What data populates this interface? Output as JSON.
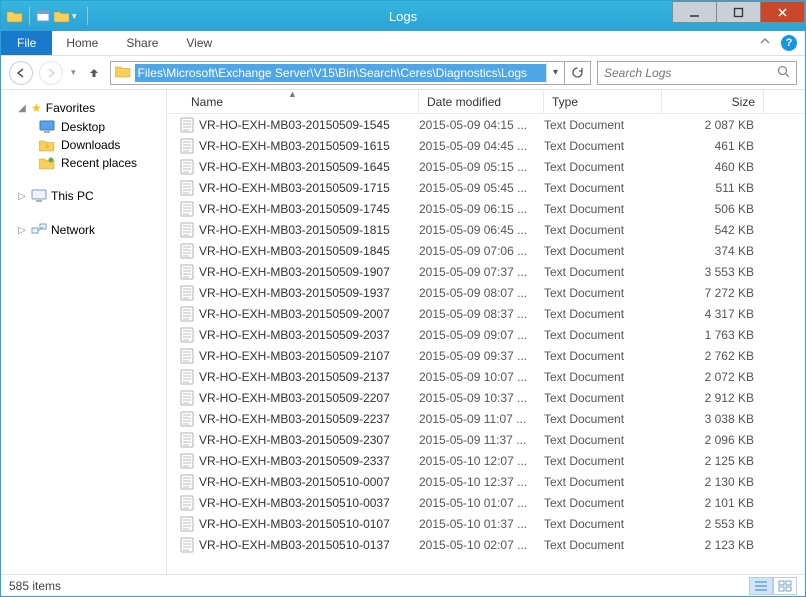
{
  "window": {
    "title": "Logs"
  },
  "ribbon": {
    "file": "File",
    "tabs": [
      "Home",
      "Share",
      "View"
    ]
  },
  "address": {
    "path": "Files\\Microsoft\\Exchange Server\\V15\\Bin\\Search\\Ceres\\Diagnostics\\Logs",
    "search_placeholder": "Search Logs"
  },
  "nav": {
    "favorites": {
      "label": "Favorites",
      "items": [
        {
          "label": "Desktop",
          "icon": "desktop"
        },
        {
          "label": "Downloads",
          "icon": "downloads"
        },
        {
          "label": "Recent places",
          "icon": "places"
        }
      ]
    },
    "thispc": {
      "label": "This PC"
    },
    "network": {
      "label": "Network"
    }
  },
  "columns": {
    "name": "Name",
    "date": "Date modified",
    "type": "Type",
    "size": "Size"
  },
  "files": [
    {
      "name": "VR-HO-EXH-MB03-20150509-1545",
      "date": "2015-05-09 04:15 ...",
      "type": "Text Document",
      "size": "2 087 KB"
    },
    {
      "name": "VR-HO-EXH-MB03-20150509-1615",
      "date": "2015-05-09 04:45 ...",
      "type": "Text Document",
      "size": "461 KB"
    },
    {
      "name": "VR-HO-EXH-MB03-20150509-1645",
      "date": "2015-05-09 05:15 ...",
      "type": "Text Document",
      "size": "460 KB"
    },
    {
      "name": "VR-HO-EXH-MB03-20150509-1715",
      "date": "2015-05-09 05:45 ...",
      "type": "Text Document",
      "size": "511 KB"
    },
    {
      "name": "VR-HO-EXH-MB03-20150509-1745",
      "date": "2015-05-09 06:15 ...",
      "type": "Text Document",
      "size": "506 KB"
    },
    {
      "name": "VR-HO-EXH-MB03-20150509-1815",
      "date": "2015-05-09 06:45 ...",
      "type": "Text Document",
      "size": "542 KB"
    },
    {
      "name": "VR-HO-EXH-MB03-20150509-1845",
      "date": "2015-05-09 07:06 ...",
      "type": "Text Document",
      "size": "374 KB"
    },
    {
      "name": "VR-HO-EXH-MB03-20150509-1907",
      "date": "2015-05-09 07:37 ...",
      "type": "Text Document",
      "size": "3 553 KB"
    },
    {
      "name": "VR-HO-EXH-MB03-20150509-1937",
      "date": "2015-05-09 08:07 ...",
      "type": "Text Document",
      "size": "7 272 KB"
    },
    {
      "name": "VR-HO-EXH-MB03-20150509-2007",
      "date": "2015-05-09 08:37 ...",
      "type": "Text Document",
      "size": "4 317 KB"
    },
    {
      "name": "VR-HO-EXH-MB03-20150509-2037",
      "date": "2015-05-09 09:07 ...",
      "type": "Text Document",
      "size": "1 763 KB"
    },
    {
      "name": "VR-HO-EXH-MB03-20150509-2107",
      "date": "2015-05-09 09:37 ...",
      "type": "Text Document",
      "size": "2 762 KB"
    },
    {
      "name": "VR-HO-EXH-MB03-20150509-2137",
      "date": "2015-05-09 10:07 ...",
      "type": "Text Document",
      "size": "2 072 KB"
    },
    {
      "name": "VR-HO-EXH-MB03-20150509-2207",
      "date": "2015-05-09 10:37 ...",
      "type": "Text Document",
      "size": "2 912 KB"
    },
    {
      "name": "VR-HO-EXH-MB03-20150509-2237",
      "date": "2015-05-09 11:07 ...",
      "type": "Text Document",
      "size": "3 038 KB"
    },
    {
      "name": "VR-HO-EXH-MB03-20150509-2307",
      "date": "2015-05-09 11:37 ...",
      "type": "Text Document",
      "size": "2 096 KB"
    },
    {
      "name": "VR-HO-EXH-MB03-20150509-2337",
      "date": "2015-05-10 12:07 ...",
      "type": "Text Document",
      "size": "2 125 KB"
    },
    {
      "name": "VR-HO-EXH-MB03-20150510-0007",
      "date": "2015-05-10 12:37 ...",
      "type": "Text Document",
      "size": "2 130 KB"
    },
    {
      "name": "VR-HO-EXH-MB03-20150510-0037",
      "date": "2015-05-10 01:07 ...",
      "type": "Text Document",
      "size": "2 101 KB"
    },
    {
      "name": "VR-HO-EXH-MB03-20150510-0107",
      "date": "2015-05-10 01:37 ...",
      "type": "Text Document",
      "size": "2 553 KB"
    },
    {
      "name": "VR-HO-EXH-MB03-20150510-0137",
      "date": "2015-05-10 02:07 ...",
      "type": "Text Document",
      "size": "2 123 KB"
    }
  ],
  "status": {
    "count_label": "585 items"
  }
}
